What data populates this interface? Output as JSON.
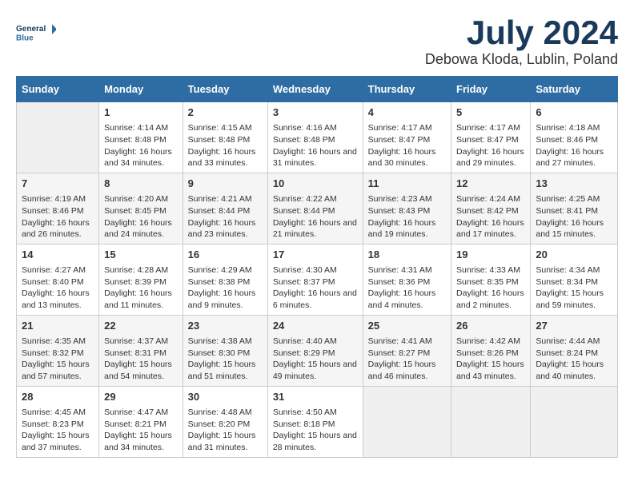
{
  "logo": {
    "line1": "General",
    "line2": "Blue"
  },
  "title": "July 2024",
  "location": "Debowa Kloda, Lublin, Poland",
  "weekdays": [
    "Sunday",
    "Monday",
    "Tuesday",
    "Wednesday",
    "Thursday",
    "Friday",
    "Saturday"
  ],
  "weeks": [
    [
      {
        "day": "",
        "sunrise": "",
        "sunset": "",
        "daylight": ""
      },
      {
        "day": "1",
        "sunrise": "Sunrise: 4:14 AM",
        "sunset": "Sunset: 8:48 PM",
        "daylight": "Daylight: 16 hours and 34 minutes."
      },
      {
        "day": "2",
        "sunrise": "Sunrise: 4:15 AM",
        "sunset": "Sunset: 8:48 PM",
        "daylight": "Daylight: 16 hours and 33 minutes."
      },
      {
        "day": "3",
        "sunrise": "Sunrise: 4:16 AM",
        "sunset": "Sunset: 8:48 PM",
        "daylight": "Daylight: 16 hours and 31 minutes."
      },
      {
        "day": "4",
        "sunrise": "Sunrise: 4:17 AM",
        "sunset": "Sunset: 8:47 PM",
        "daylight": "Daylight: 16 hours and 30 minutes."
      },
      {
        "day": "5",
        "sunrise": "Sunrise: 4:17 AM",
        "sunset": "Sunset: 8:47 PM",
        "daylight": "Daylight: 16 hours and 29 minutes."
      },
      {
        "day": "6",
        "sunrise": "Sunrise: 4:18 AM",
        "sunset": "Sunset: 8:46 PM",
        "daylight": "Daylight: 16 hours and 27 minutes."
      }
    ],
    [
      {
        "day": "7",
        "sunrise": "Sunrise: 4:19 AM",
        "sunset": "Sunset: 8:46 PM",
        "daylight": "Daylight: 16 hours and 26 minutes."
      },
      {
        "day": "8",
        "sunrise": "Sunrise: 4:20 AM",
        "sunset": "Sunset: 8:45 PM",
        "daylight": "Daylight: 16 hours and 24 minutes."
      },
      {
        "day": "9",
        "sunrise": "Sunrise: 4:21 AM",
        "sunset": "Sunset: 8:44 PM",
        "daylight": "Daylight: 16 hours and 23 minutes."
      },
      {
        "day": "10",
        "sunrise": "Sunrise: 4:22 AM",
        "sunset": "Sunset: 8:44 PM",
        "daylight": "Daylight: 16 hours and 21 minutes."
      },
      {
        "day": "11",
        "sunrise": "Sunrise: 4:23 AM",
        "sunset": "Sunset: 8:43 PM",
        "daylight": "Daylight: 16 hours and 19 minutes."
      },
      {
        "day": "12",
        "sunrise": "Sunrise: 4:24 AM",
        "sunset": "Sunset: 8:42 PM",
        "daylight": "Daylight: 16 hours and 17 minutes."
      },
      {
        "day": "13",
        "sunrise": "Sunrise: 4:25 AM",
        "sunset": "Sunset: 8:41 PM",
        "daylight": "Daylight: 16 hours and 15 minutes."
      }
    ],
    [
      {
        "day": "14",
        "sunrise": "Sunrise: 4:27 AM",
        "sunset": "Sunset: 8:40 PM",
        "daylight": "Daylight: 16 hours and 13 minutes."
      },
      {
        "day": "15",
        "sunrise": "Sunrise: 4:28 AM",
        "sunset": "Sunset: 8:39 PM",
        "daylight": "Daylight: 16 hours and 11 minutes."
      },
      {
        "day": "16",
        "sunrise": "Sunrise: 4:29 AM",
        "sunset": "Sunset: 8:38 PM",
        "daylight": "Daylight: 16 hours and 9 minutes."
      },
      {
        "day": "17",
        "sunrise": "Sunrise: 4:30 AM",
        "sunset": "Sunset: 8:37 PM",
        "daylight": "Daylight: 16 hours and 6 minutes."
      },
      {
        "day": "18",
        "sunrise": "Sunrise: 4:31 AM",
        "sunset": "Sunset: 8:36 PM",
        "daylight": "Daylight: 16 hours and 4 minutes."
      },
      {
        "day": "19",
        "sunrise": "Sunrise: 4:33 AM",
        "sunset": "Sunset: 8:35 PM",
        "daylight": "Daylight: 16 hours and 2 minutes."
      },
      {
        "day": "20",
        "sunrise": "Sunrise: 4:34 AM",
        "sunset": "Sunset: 8:34 PM",
        "daylight": "Daylight: 15 hours and 59 minutes."
      }
    ],
    [
      {
        "day": "21",
        "sunrise": "Sunrise: 4:35 AM",
        "sunset": "Sunset: 8:32 PM",
        "daylight": "Daylight: 15 hours and 57 minutes."
      },
      {
        "day": "22",
        "sunrise": "Sunrise: 4:37 AM",
        "sunset": "Sunset: 8:31 PM",
        "daylight": "Daylight: 15 hours and 54 minutes."
      },
      {
        "day": "23",
        "sunrise": "Sunrise: 4:38 AM",
        "sunset": "Sunset: 8:30 PM",
        "daylight": "Daylight: 15 hours and 51 minutes."
      },
      {
        "day": "24",
        "sunrise": "Sunrise: 4:40 AM",
        "sunset": "Sunset: 8:29 PM",
        "daylight": "Daylight: 15 hours and 49 minutes."
      },
      {
        "day": "25",
        "sunrise": "Sunrise: 4:41 AM",
        "sunset": "Sunset: 8:27 PM",
        "daylight": "Daylight: 15 hours and 46 minutes."
      },
      {
        "day": "26",
        "sunrise": "Sunrise: 4:42 AM",
        "sunset": "Sunset: 8:26 PM",
        "daylight": "Daylight: 15 hours and 43 minutes."
      },
      {
        "day": "27",
        "sunrise": "Sunrise: 4:44 AM",
        "sunset": "Sunset: 8:24 PM",
        "daylight": "Daylight: 15 hours and 40 minutes."
      }
    ],
    [
      {
        "day": "28",
        "sunrise": "Sunrise: 4:45 AM",
        "sunset": "Sunset: 8:23 PM",
        "daylight": "Daylight: 15 hours and 37 minutes."
      },
      {
        "day": "29",
        "sunrise": "Sunrise: 4:47 AM",
        "sunset": "Sunset: 8:21 PM",
        "daylight": "Daylight: 15 hours and 34 minutes."
      },
      {
        "day": "30",
        "sunrise": "Sunrise: 4:48 AM",
        "sunset": "Sunset: 8:20 PM",
        "daylight": "Daylight: 15 hours and 31 minutes."
      },
      {
        "day": "31",
        "sunrise": "Sunrise: 4:50 AM",
        "sunset": "Sunset: 8:18 PM",
        "daylight": "Daylight: 15 hours and 28 minutes."
      },
      {
        "day": "",
        "sunrise": "",
        "sunset": "",
        "daylight": ""
      },
      {
        "day": "",
        "sunrise": "",
        "sunset": "",
        "daylight": ""
      },
      {
        "day": "",
        "sunrise": "",
        "sunset": "",
        "daylight": ""
      }
    ]
  ]
}
